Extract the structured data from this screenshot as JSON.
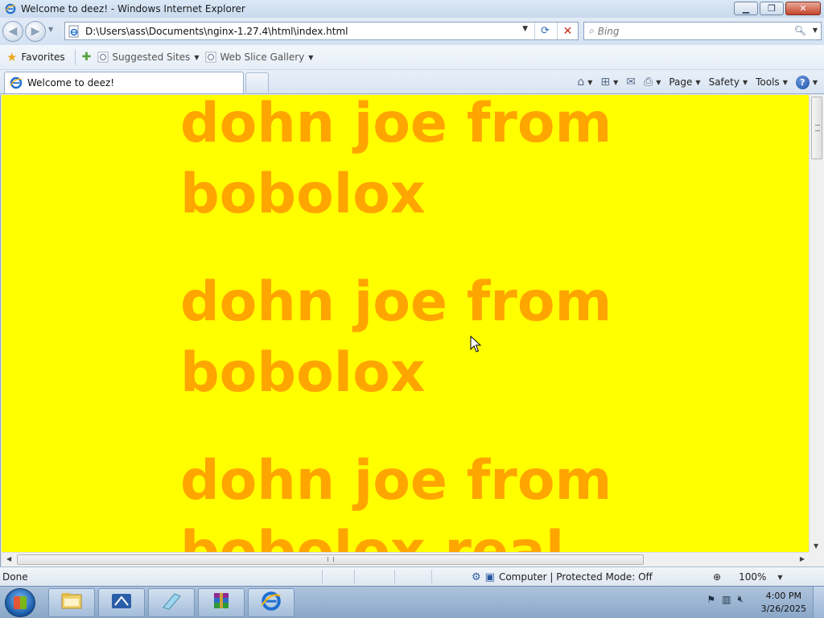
{
  "window": {
    "title": "Welcome to deez! - Windows Internet Explorer"
  },
  "addressbar": {
    "url": "D:\\Users\\ass\\Documents\\nginx-1.27.4\\html\\index.html"
  },
  "search": {
    "placeholder": "Bing"
  },
  "favorites_bar": {
    "favorites_label": "Favorites",
    "items": [
      {
        "label": "Suggested Sites"
      },
      {
        "label": "Web Slice Gallery"
      }
    ]
  },
  "tab": {
    "label": "Welcome to deez!"
  },
  "commandbar": {
    "page": "Page",
    "safety": "Safety",
    "tools": "Tools"
  },
  "page": {
    "background": "#ffff00",
    "heading_color": "#ffa500",
    "headings": [
      "dohn joe from bobolox",
      "dohn joe from bobolox",
      "dohn joe from bobolox real"
    ]
  },
  "statusbar": {
    "status": "Done",
    "zone": "Computer | Protected Mode: Off",
    "zoom": "100%"
  },
  "taskbar": {
    "time": "4:00 PM",
    "date": "3/26/2025",
    "pinned_icons": [
      "explorer-folder-icon",
      "network-icon",
      "notepad-icon",
      "winrar-icon",
      "internet-explorer-icon"
    ]
  }
}
